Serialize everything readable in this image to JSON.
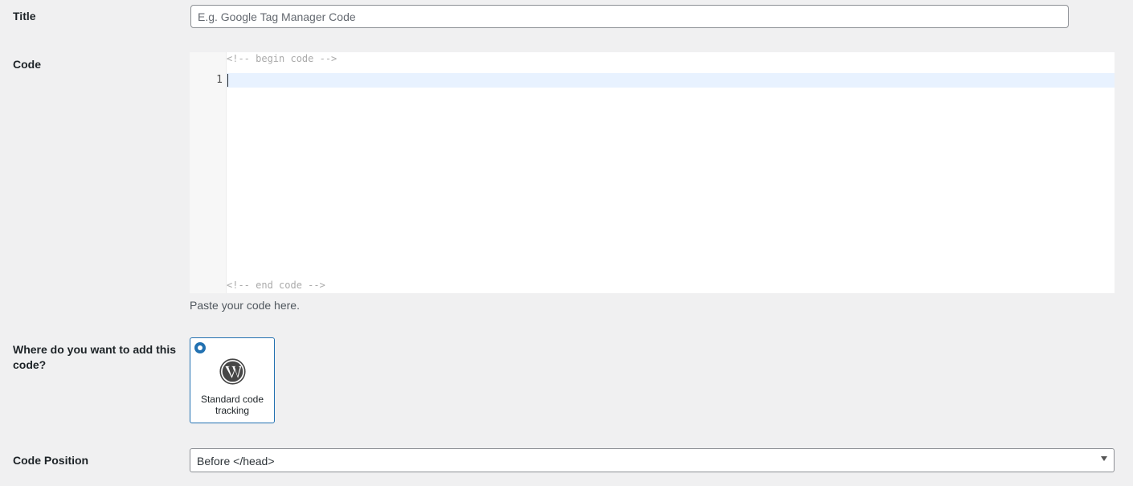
{
  "title_field": {
    "label": "Title",
    "placeholder": "E.g. Google Tag Manager Code",
    "value": ""
  },
  "code_field": {
    "label": "Code",
    "begin_comment": "<!-- begin code -->",
    "end_comment": "<!-- end code -->",
    "line_numbers": [
      "1"
    ],
    "help_text": "Paste your code here."
  },
  "location_field": {
    "label": "Where do you want to add this code?",
    "options": [
      {
        "label": "Standard code tracking",
        "icon": "wordpress-icon",
        "selected": true
      }
    ]
  },
  "position_field": {
    "label": "Code Position",
    "selected": "Before </head>"
  },
  "colors": {
    "accent": "#2271b1",
    "background": "#f0f0f1",
    "active_line": "#e8f2ff"
  }
}
